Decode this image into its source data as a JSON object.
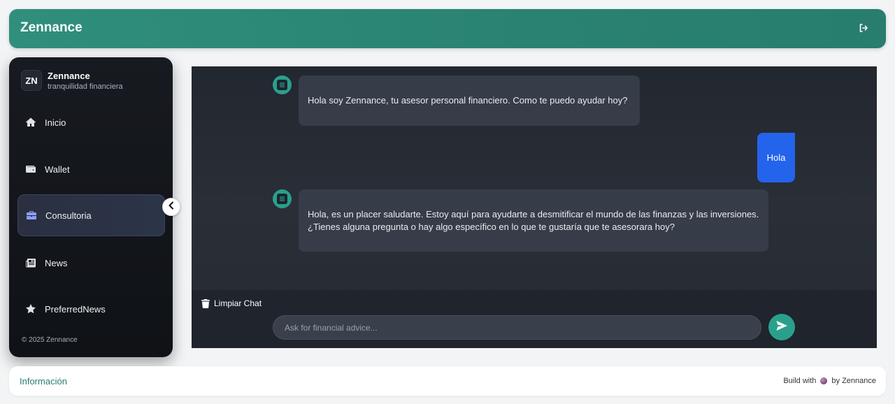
{
  "header": {
    "brand": "Zennance",
    "logout_icon": "logout-icon"
  },
  "sidebar": {
    "logo_initials": "ZN",
    "app_name": "Zennance",
    "tagline": "tranquilidad financiera",
    "items": [
      {
        "label": "Inicio",
        "icon": "home-icon"
      },
      {
        "label": "Wallet",
        "icon": "wallet-icon"
      },
      {
        "label": "Consultoria",
        "icon": "briefcase-icon",
        "active": true
      },
      {
        "label": "News",
        "icon": "newspaper-icon"
      },
      {
        "label": "PreferredNews",
        "icon": "star-icon"
      }
    ],
    "footer": "© 2025 Zennance"
  },
  "chat": {
    "messages": [
      {
        "from": "bot",
        "text": "Hola soy Zennance, tu asesor personal financiero. Como te puedo ayudar hoy?"
      },
      {
        "from": "user",
        "text": "Hola"
      },
      {
        "from": "bot",
        "text": "Hola, es un placer saludarte. Estoy aquí para ayudarte a desmitificar el mundo de las finanzas y las inversiones. ¿Tienes alguna pregunta o hay algo específico en lo que te gustaría que te asesorara hoy?"
      }
    ],
    "clear_label": "Limpiar Chat",
    "input_placeholder": "Ask for financial advice...",
    "input_value": ""
  },
  "footer": {
    "info_label": "Información",
    "built_prefix": "Build with",
    "built_suffix": "by Zennance"
  },
  "colors": {
    "accent": "#2aa08c",
    "user_bubble": "#2463eb",
    "bot_bubble": "#363c48",
    "sidebar_active_icon": "#8f9cf7"
  }
}
